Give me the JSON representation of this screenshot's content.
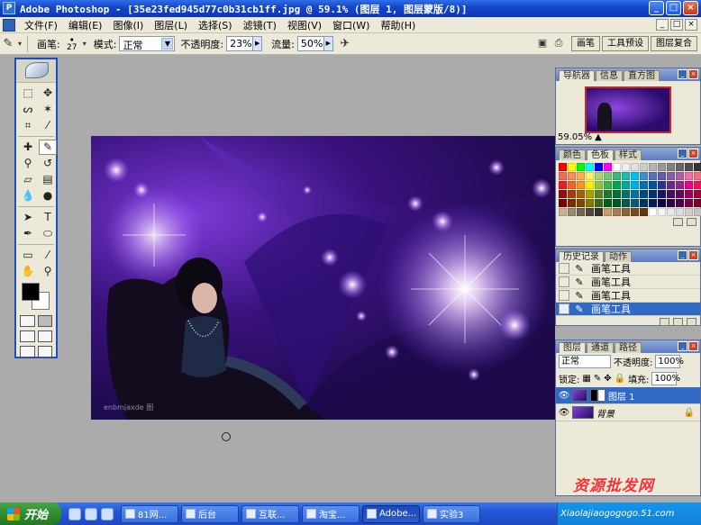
{
  "window": {
    "title": "Adobe Photoshop - [35e23fed945d77c0b31cb1ff.jpg @ 59.1% (图层 1, 图层蒙版/8)]",
    "icon": "photoshop-app-icon",
    "controls": [
      "_",
      "□",
      "×"
    ]
  },
  "menu": {
    "items": [
      "文件(F)",
      "编辑(E)",
      "图像(I)",
      "图层(L)",
      "选择(S)",
      "滤镜(T)",
      "视图(V)",
      "窗口(W)",
      "帮助(H)"
    ],
    "doc_controls": [
      "_",
      "□",
      "×"
    ]
  },
  "options": {
    "brush_label": "画笔:",
    "brush_size": "27",
    "mode_label": "模式:",
    "mode_value": "正常",
    "opacity_label": "不透明度:",
    "opacity_value": "23%",
    "flow_label": "流量:",
    "flow_value": "50%",
    "well_tabs": [
      "画笔",
      "工具预设",
      "图层复合"
    ]
  },
  "navigator": {
    "tabs": [
      "导航器",
      "信息",
      "直方图"
    ],
    "zoom": "59.05%"
  },
  "swatches": {
    "tabs": [
      "颜色",
      "色板",
      "样式"
    ],
    "colors": [
      "#ff0000",
      "#ffff00",
      "#00ff00",
      "#00ffff",
      "#0000ff",
      "#ff00ff",
      "#ffffff",
      "#f0f0f0",
      "#e0e0e0",
      "#cccccc",
      "#b3b3b3",
      "#999999",
      "#808080",
      "#666666",
      "#4d4d4d",
      "#333333",
      "#f26c4f",
      "#f68e55",
      "#fbad4a",
      "#fff467",
      "#acd372",
      "#7cc576",
      "#3bb878",
      "#1abbb4",
      "#00bff3",
      "#438cca",
      "#5574b9",
      "#605ca8",
      "#855fa8",
      "#a763a8",
      "#f06ea9",
      "#f26d7d",
      "#ed1c24",
      "#f26522",
      "#f7941d",
      "#fff200",
      "#8dc73f",
      "#39b54a",
      "#00a651",
      "#00a99d",
      "#00aeef",
      "#0072bc",
      "#0054a6",
      "#2e3192",
      "#662d91",
      "#92278f",
      "#ec008c",
      "#ed145b",
      "#9e0b0f",
      "#a0410d",
      "#a36209",
      "#aba000",
      "#598527",
      "#1a7b30",
      "#007236",
      "#00746b",
      "#0076a3",
      "#004b80",
      "#003471",
      "#1b1464",
      "#440e62",
      "#630460",
      "#9e005d",
      "#9e0039",
      "#790000",
      "#7b2e00",
      "#7d4900",
      "#827b00",
      "#406618",
      "#005e20",
      "#005826",
      "#005952",
      "#005b7f",
      "#003663",
      "#002157",
      "#0d004c",
      "#32004b",
      "#4b0049",
      "#7b0046",
      "#7a0026",
      "#c7b299",
      "#998675",
      "#736357",
      "#534741",
      "#37302d",
      "#c69c6d",
      "#a67c52",
      "#8c6239",
      "#754c24",
      "#603913",
      "#ffffff",
      "#f5f5f5",
      "#e8e8e8",
      "#dcdcdc",
      "#d0d0d0",
      "#c4c4c4"
    ]
  },
  "history": {
    "tabs": [
      "历史记录",
      "动作"
    ],
    "items": [
      "画笔工具",
      "画笔工具",
      "画笔工具",
      "画笔工具"
    ],
    "selected_index": 3
  },
  "layers": {
    "tabs": [
      "图层",
      "通道",
      "路径"
    ],
    "blend_mode": "正常",
    "opacity_label": "不透明度:",
    "opacity_value": "100%",
    "lock_label": "锁定:",
    "fill_label": "填充:",
    "fill_value": "100%",
    "items": [
      {
        "name": "图层 1",
        "selected": true
      },
      {
        "name": "背景",
        "selected": false
      }
    ]
  },
  "canvas": {
    "watermark": "enbmjaxde 图"
  },
  "taskbar": {
    "start_label": "开始",
    "tasks": [
      "81网...",
      "后台",
      "互联...",
      "淘宝...",
      "Adobe...",
      "实验3"
    ],
    "active_index": 4
  },
  "overlay": {
    "logo": "资源批发网",
    "url": "Xiaolajiaogogogo.51.com"
  },
  "colors": {
    "titlebar": "#1444c8",
    "canvas_purple": "#4a1aa0",
    "selection": "#316ac5"
  }
}
